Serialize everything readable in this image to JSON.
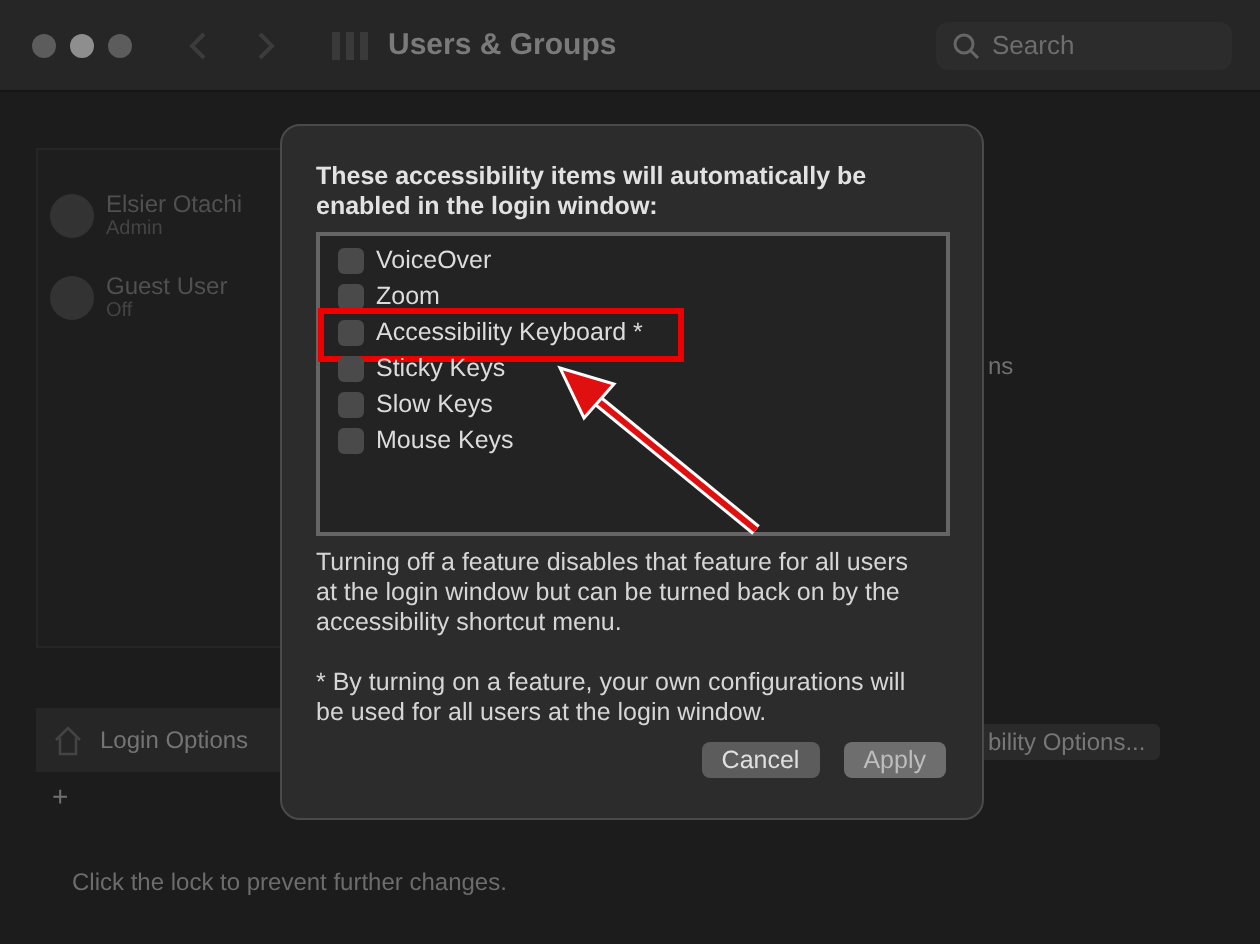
{
  "window": {
    "title": "Users & Groups"
  },
  "search": {
    "placeholder": "Search"
  },
  "sidebar": {
    "users": [
      {
        "name": "Elsier Otachi",
        "role": "Admin"
      },
      {
        "name": "Guest User",
        "role": "Off"
      }
    ],
    "login_options": "Login Options",
    "add": "+"
  },
  "lock_text": "Click the lock to prevent further changes.",
  "right_panel": {
    "text_fragment": "ns",
    "button": "bility Options..."
  },
  "sheet": {
    "heading": "These accessibility items will automatically be enabled in the login window:",
    "items": [
      {
        "label": "VoiceOver",
        "checked": false,
        "highlighted": false
      },
      {
        "label": "Zoom",
        "checked": false,
        "highlighted": false
      },
      {
        "label": "Accessibility Keyboard *",
        "checked": false,
        "highlighted": true
      },
      {
        "label": "Sticky Keys",
        "checked": false,
        "highlighted": false
      },
      {
        "label": "Slow Keys",
        "checked": false,
        "highlighted": false
      },
      {
        "label": "Mouse Keys",
        "checked": false,
        "highlighted": false
      }
    ],
    "note": "Turning off a feature disables that feature for all users at the login window but can be turned back on by the accessibility shortcut menu.",
    "footnote": "* By turning on a feature, your own configurations will be used for all users at the login window.",
    "buttons": [
      {
        "label": "Cancel",
        "kind": "secondary"
      },
      {
        "label": "Apply",
        "kind": "default"
      }
    ]
  }
}
